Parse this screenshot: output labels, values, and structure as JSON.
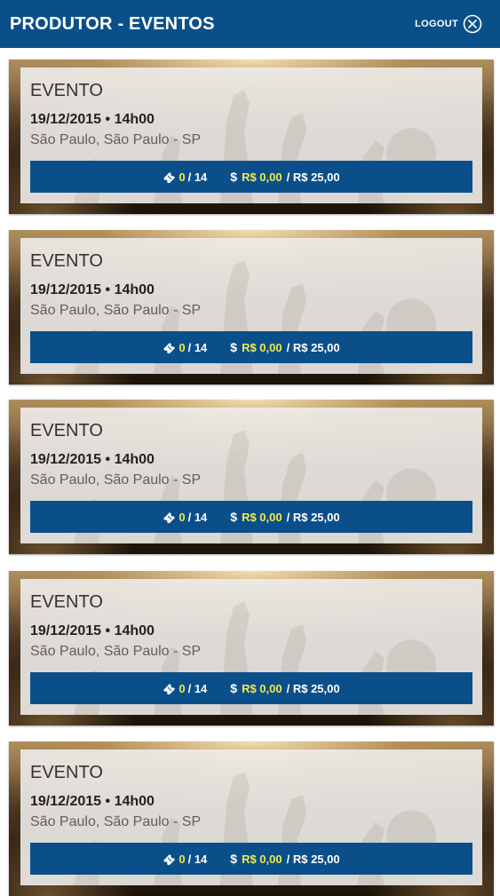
{
  "header": {
    "title": "PRODUTOR - EVENTOS",
    "logout_label": "LOGOUT"
  },
  "colors": {
    "primary": "#0b4f8a",
    "highlight": "#f3e94a"
  },
  "icons": {
    "logout": "close-circle-icon",
    "tickets": "ticket-icon",
    "revenue": "dollar-icon"
  },
  "events": [
    {
      "title": "EVENTO",
      "datetime": "19/12/2015 • 14h00",
      "location": "São Paulo, São Paulo - SP",
      "tickets_sold": "0",
      "tickets_total": "/ 14",
      "revenue_current": "R$ 0,00",
      "revenue_total": "/ R$ 25,00"
    },
    {
      "title": "EVENTO",
      "datetime": "19/12/2015 • 14h00",
      "location": "São Paulo, São Paulo - SP",
      "tickets_sold": "0",
      "tickets_total": "/ 14",
      "revenue_current": "R$ 0,00",
      "revenue_total": "/ R$ 25,00"
    },
    {
      "title": "EVENTO",
      "datetime": "19/12/2015 • 14h00",
      "location": "São Paulo, São Paulo - SP",
      "tickets_sold": "0",
      "tickets_total": "/ 14",
      "revenue_current": "R$ 0,00",
      "revenue_total": "/ R$ 25,00"
    },
    {
      "title": "EVENTO",
      "datetime": "19/12/2015 • 14h00",
      "location": "São Paulo, São Paulo - SP",
      "tickets_sold": "0",
      "tickets_total": "/ 14",
      "revenue_current": "R$ 0,00",
      "revenue_total": "/ R$ 25,00"
    },
    {
      "title": "EVENTO",
      "datetime": "19/12/2015 • 14h00",
      "location": "São Paulo, São Paulo - SP",
      "tickets_sold": "0",
      "tickets_total": "/ 14",
      "revenue_current": "R$ 0,00",
      "revenue_total": "/ R$ 25,00"
    }
  ]
}
